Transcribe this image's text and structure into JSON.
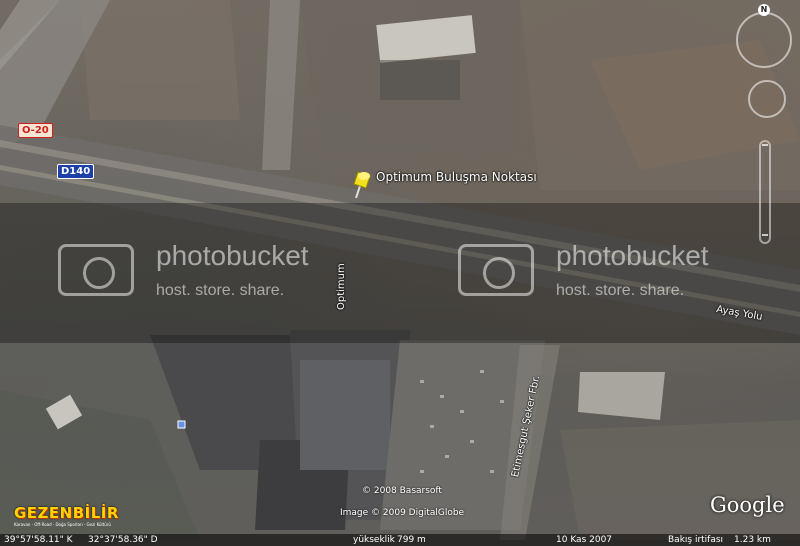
{
  "map": {
    "placemark_label": "Optimum Buluşma Noktası",
    "road_shields": {
      "o20": "O-20",
      "d140": "D140"
    },
    "street_labels": {
      "optimum": "Optimum",
      "ayas_yolu": "Ayaş Yolu",
      "etimesgut": "Etimesgut Şeker Fbr."
    },
    "compass_letter": "N",
    "watermark": {
      "word": "photobucket",
      "tagline": "host. store. share."
    },
    "credits": {
      "copyright": "© 2008 Basarsoft",
      "image_credit": "Image © 2009 DigitalGlobe"
    },
    "google_logo": "Google",
    "brand_logo": {
      "name": "GEZENBİLİR",
      "tagline": "Karavan · Off-Road · Doğa Sporları · Gezi Kültürü"
    }
  },
  "status": {
    "lat": "39°57'58.11\" K",
    "lon": "32°37'58.36\" D",
    "elevation_label": "yükseklik",
    "elevation_value": "799 m",
    "date": "10 Kas 2007",
    "eye_label": "Bakış irtifası",
    "eye_value": "1.23 km"
  }
}
